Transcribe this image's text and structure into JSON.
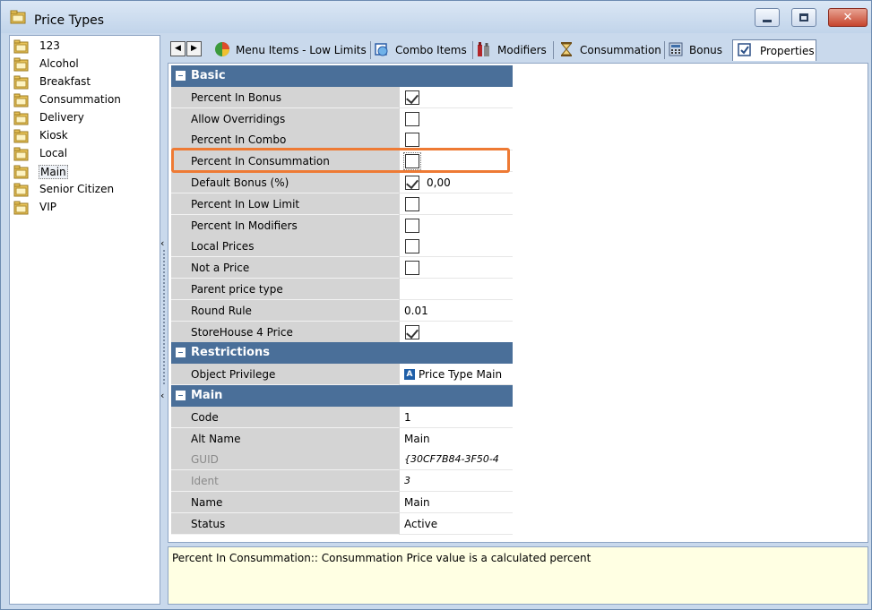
{
  "window": {
    "title": "Price Types"
  },
  "colors": {
    "section_header": "#4a6f99",
    "highlight": "#ee7a34",
    "description_bg": "#ffffe3"
  },
  "tree": {
    "items": [
      {
        "label": "123",
        "selected": false
      },
      {
        "label": "Alcohol",
        "selected": false
      },
      {
        "label": "Breakfast",
        "selected": false
      },
      {
        "label": "Consummation",
        "selected": false
      },
      {
        "label": "Delivery",
        "selected": false
      },
      {
        "label": "Kiosk",
        "selected": false
      },
      {
        "label": "Local",
        "selected": false
      },
      {
        "label": "Main",
        "selected": true
      },
      {
        "label": "Senior Citizen",
        "selected": false
      },
      {
        "label": "VIP",
        "selected": false
      }
    ]
  },
  "tabs": [
    {
      "label": "Menu Items - Low Limits",
      "icon": "pie-chart-icon"
    },
    {
      "label": "Combo Items",
      "icon": "combo-icon"
    },
    {
      "label": "Modifiers",
      "icon": "bottles-icon"
    },
    {
      "label": "Consummation",
      "icon": "hourglass-icon"
    },
    {
      "label": "Bonus",
      "icon": "calculator-icon"
    },
    {
      "label": "Properties",
      "icon": "properties-icon",
      "active": true
    }
  ],
  "properties": {
    "basic": {
      "title": "Basic",
      "rows": [
        {
          "name": "Percent In Bonus",
          "checkbox": true,
          "checked": true
        },
        {
          "name": "Allow Overridings",
          "checkbox": true,
          "checked": false
        },
        {
          "name": "Percent In Combo",
          "checkbox": true,
          "checked": false
        },
        {
          "name": "Percent In Consummation",
          "checkbox": true,
          "checked": false
        },
        {
          "name": "Default Bonus (%)",
          "checkbox": true,
          "checked": true,
          "value": "0,00"
        },
        {
          "name": "Percent In Low Limit",
          "checkbox": true,
          "checked": false
        },
        {
          "name": "Percent In Modifiers",
          "checkbox": true,
          "checked": false
        },
        {
          "name": "Local Prices",
          "checkbox": true,
          "checked": false
        },
        {
          "name": "Not a Price",
          "checkbox": true,
          "checked": false
        },
        {
          "name": "Parent price type",
          "value": ""
        },
        {
          "name": "Round Rule",
          "value": "0.01"
        },
        {
          "name": "StoreHouse 4 Price",
          "checkbox": true,
          "checked": true
        }
      ]
    },
    "restrictions": {
      "title": "Restrictions",
      "rows": [
        {
          "name": "Object Privilege",
          "value": "Price Type Main",
          "icon_letter": "A"
        }
      ]
    },
    "main": {
      "title": "Main",
      "rows": [
        {
          "name": "Code",
          "value": "1"
        },
        {
          "name": "Alt Name",
          "value": "Main"
        },
        {
          "name": "GUID",
          "value": "{30CF7B84-3F50-4",
          "disabled": true
        },
        {
          "name": "Ident",
          "value": "3",
          "disabled": true
        },
        {
          "name": "Name",
          "value": "Main"
        },
        {
          "name": "Status",
          "value": "Active"
        }
      ]
    }
  },
  "description": "Percent In Consummation:: Consummation Price value is a calculated percent"
}
